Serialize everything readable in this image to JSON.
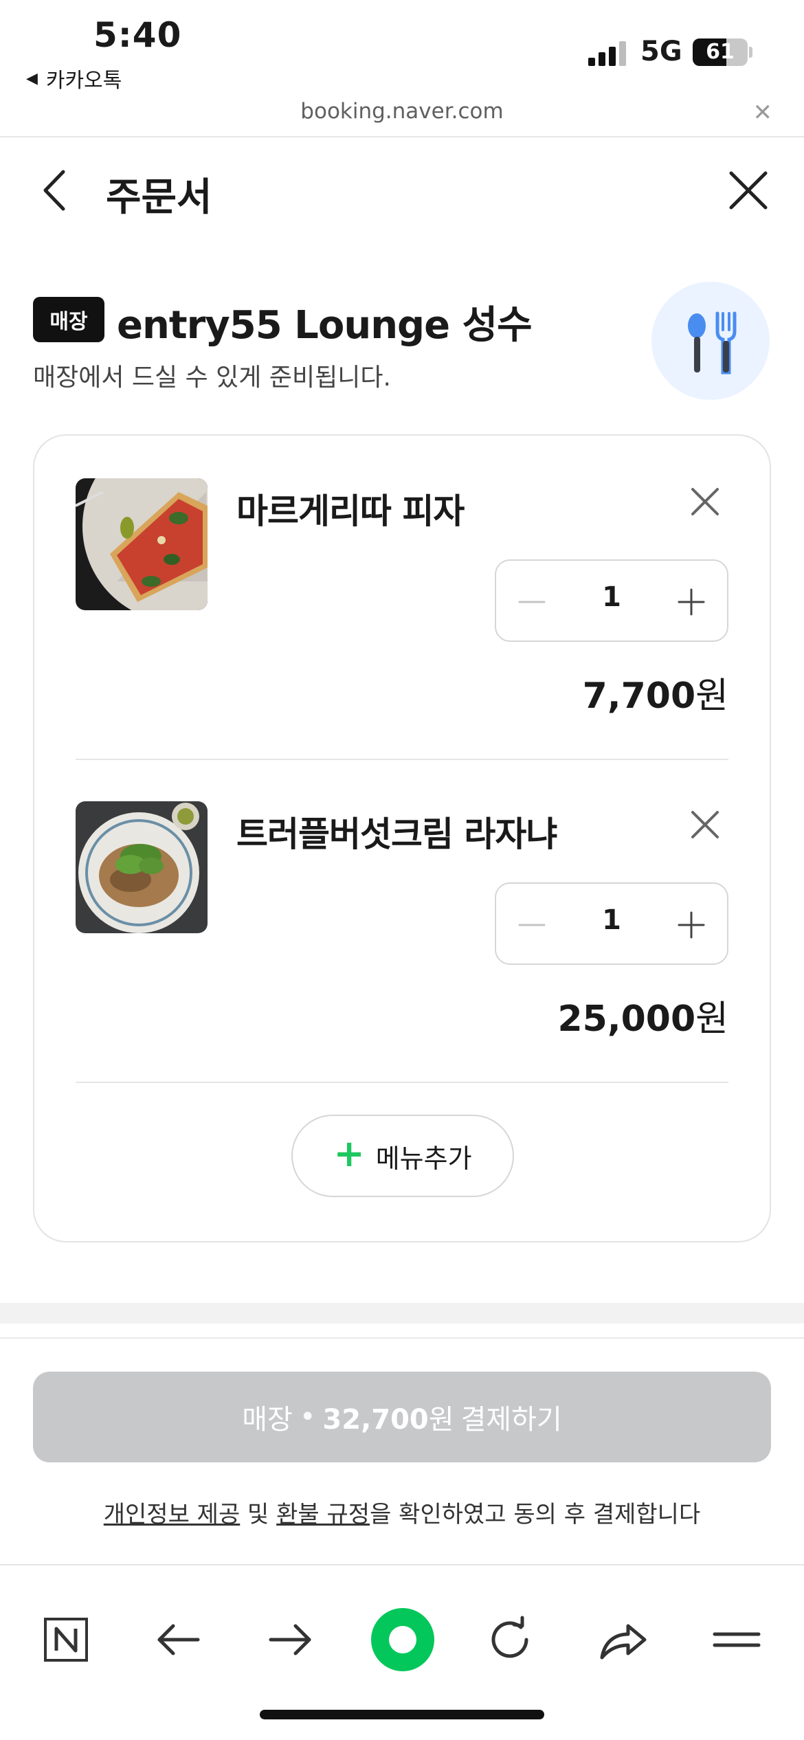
{
  "status_bar": {
    "time": "5:40",
    "back_app": "카카오톡",
    "network": "5G",
    "battery_percent": 61,
    "battery_label": "61"
  },
  "url_bar": {
    "url": "booking.naver.com"
  },
  "header": {
    "title": "주문서"
  },
  "store": {
    "badge": "매장",
    "name": "entry55 Lounge 성수",
    "description": "매장에서 드실 수 있게 준비됩니다.",
    "icon": "utensils-icon"
  },
  "order": {
    "items": [
      {
        "name": "마르게리따 피자",
        "quantity": "1",
        "price": "7,700",
        "unit": "원"
      },
      {
        "name": "트러플버섯크림 라자냐",
        "quantity": "1",
        "price": "25,000",
        "unit": "원"
      }
    ],
    "add_menu_label": "메뉴추가"
  },
  "payment": {
    "type_label": "매장",
    "separator": "•",
    "total": "32,700",
    "unit": "원",
    "action": "결제하기"
  },
  "agreement": {
    "link1": "개인정보 제공",
    "conj": " 및 ",
    "link2": "환불 규정",
    "rest": "을 확인하였고 동의 후 결제합니다"
  },
  "colors": {
    "accent_green": "#1fc760",
    "naver_green": "#03c75a",
    "pay_disabled": "#c7c8ca",
    "badge_bg": "#111111"
  },
  "toolbar": {
    "icons": [
      "naver-logo-icon",
      "back-arrow-icon",
      "forward-arrow-icon",
      "green-dot-icon",
      "refresh-icon",
      "share-icon",
      "menu-icon"
    ]
  }
}
